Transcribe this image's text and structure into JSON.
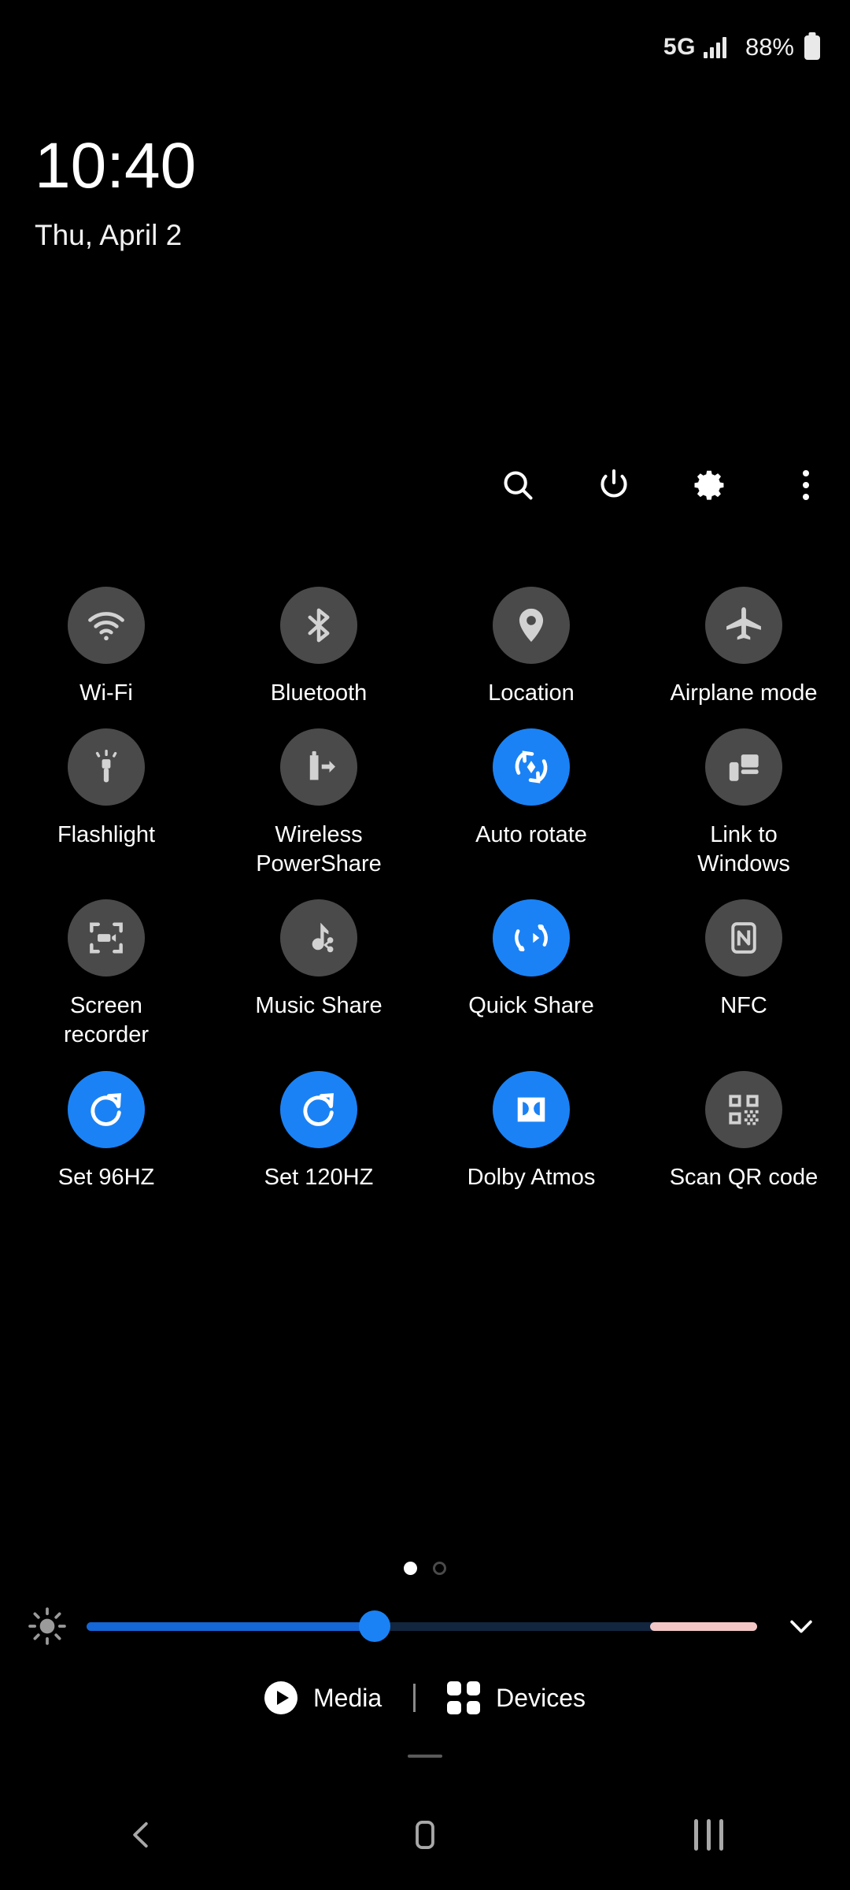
{
  "status_bar": {
    "network": "5G",
    "signal_icon": "signal-bars-icon",
    "battery_percent": "88%",
    "battery_icon": "battery-icon"
  },
  "clock": {
    "time": "10:40",
    "date": "Thu, April 2"
  },
  "toolbar": {
    "items": [
      {
        "name": "search-icon",
        "label": "Search"
      },
      {
        "name": "power-icon",
        "label": "Power"
      },
      {
        "name": "gear-icon",
        "label": "Settings"
      },
      {
        "name": "overflow-menu-icon",
        "label": "More options"
      }
    ]
  },
  "tiles": [
    {
      "label": "Wi-Fi",
      "icon": "wifi-icon",
      "active": false
    },
    {
      "label": "Bluetooth",
      "icon": "bluetooth-icon",
      "active": false
    },
    {
      "label": "Location",
      "icon": "location-pin-icon",
      "active": false
    },
    {
      "label": "Airplane mode",
      "icon": "airplane-icon",
      "active": false
    },
    {
      "label": "Flashlight",
      "icon": "flashlight-icon",
      "active": false
    },
    {
      "label": "Wireless PowerShare",
      "icon": "wireless-powershare-icon",
      "active": false
    },
    {
      "label": "Auto rotate",
      "icon": "auto-rotate-icon",
      "active": true
    },
    {
      "label": "Link to Windows",
      "icon": "link-to-windows-icon",
      "active": false
    },
    {
      "label": "Screen recorder",
      "icon": "screen-recorder-icon",
      "active": false
    },
    {
      "label": "Music Share",
      "icon": "music-share-icon",
      "active": false
    },
    {
      "label": "Quick Share",
      "icon": "quick-share-icon",
      "active": true
    },
    {
      "label": "NFC",
      "icon": "nfc-icon",
      "active": false
    },
    {
      "label": "Set 96HZ",
      "icon": "refresh-rate-icon",
      "active": true
    },
    {
      "label": "Set 120HZ",
      "icon": "refresh-rate-icon",
      "active": true
    },
    {
      "label": "Dolby Atmos",
      "icon": "dolby-atmos-icon",
      "active": true
    },
    {
      "label": "Scan QR code",
      "icon": "qr-code-icon",
      "active": false
    }
  ],
  "pager": {
    "pages": 2,
    "active_index": 0
  },
  "brightness": {
    "icon": "brightness-sun-icon",
    "value_percent": 43,
    "expand_icon": "chevron-down-icon"
  },
  "footer": {
    "media_label": "Media",
    "media_icon": "play-circle-icon",
    "devices_label": "Devices",
    "devices_icon": "devices-grid-icon"
  },
  "nav_bar": {
    "back_icon": "back-chevron-icon",
    "home_icon": "home-square-icon",
    "recents_icon": "recents-bars-icon"
  },
  "colors": {
    "background": "#000000",
    "tile_inactive": "#4a4a4a",
    "tile_active": "#1a82f5",
    "slider_fill": "#1566d6",
    "slider_track": "#12263f",
    "slider_pink": "#f3c7c5",
    "text": "#ffffff"
  }
}
